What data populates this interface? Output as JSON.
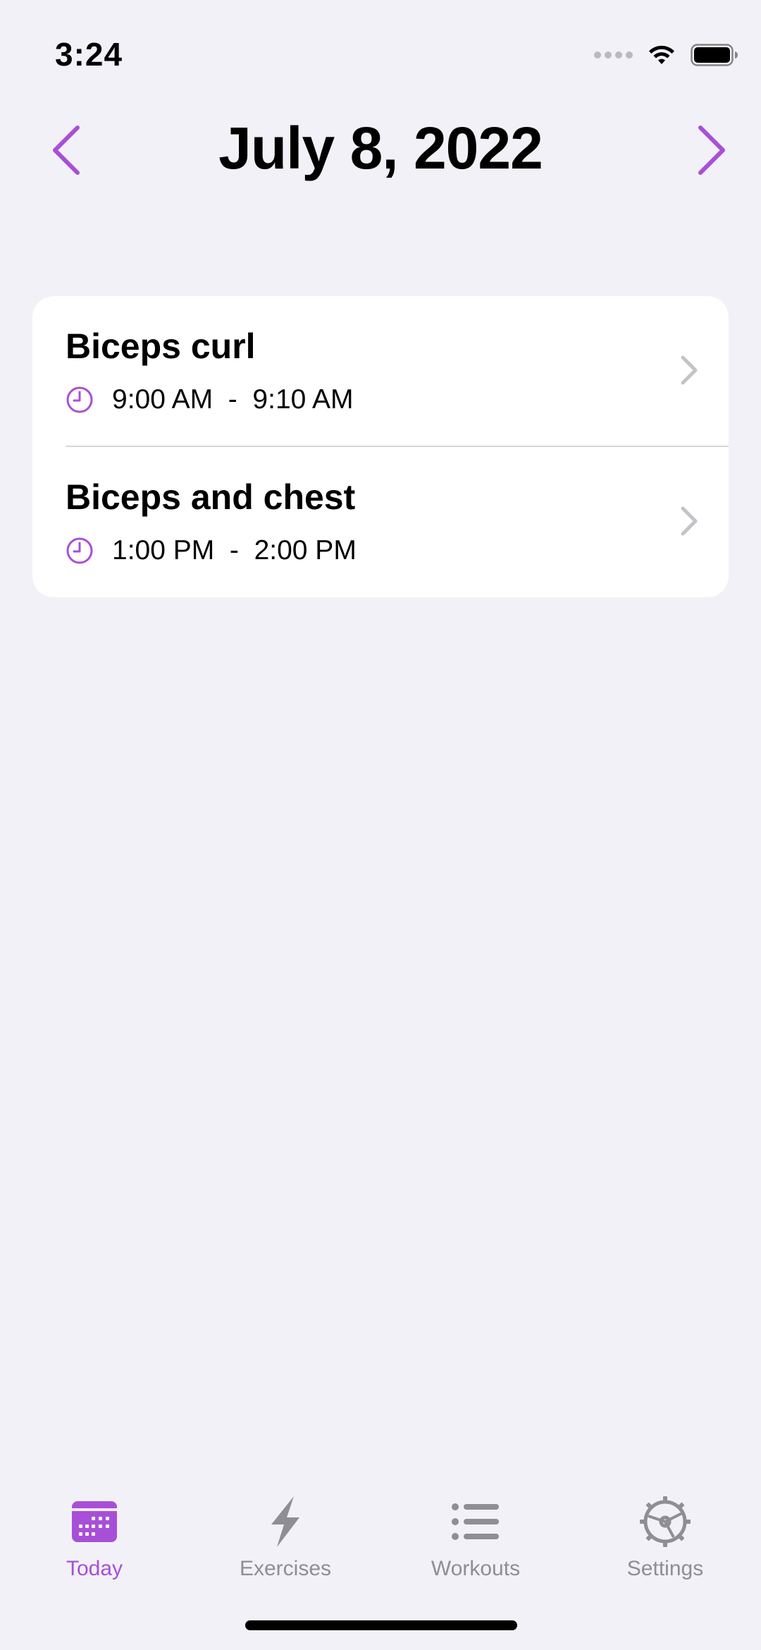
{
  "status_bar": {
    "time": "3:24",
    "icons": [
      "cellular-dots-icon",
      "wifi-icon",
      "battery-icon"
    ]
  },
  "header": {
    "date_title": "July 8, 2022",
    "prev_icon": "chevron-left-icon",
    "next_icon": "chevron-right-icon"
  },
  "colors": {
    "accent": "#a84fd8",
    "background": "#f2f1f7",
    "inactive": "#8e8e93"
  },
  "workouts": [
    {
      "title": "Biceps curl",
      "time_range": "9:00 AM  -  9:10 AM"
    },
    {
      "title": "Biceps and chest",
      "time_range": "1:00 PM  -  2:00 PM"
    }
  ],
  "tabs": [
    {
      "label": "Today",
      "icon": "calendar-icon",
      "active": true
    },
    {
      "label": "Exercises",
      "icon": "lightning-icon",
      "active": false
    },
    {
      "label": "Workouts",
      "icon": "list-icon",
      "active": false
    },
    {
      "label": "Settings",
      "icon": "gear-icon",
      "active": false
    }
  ]
}
